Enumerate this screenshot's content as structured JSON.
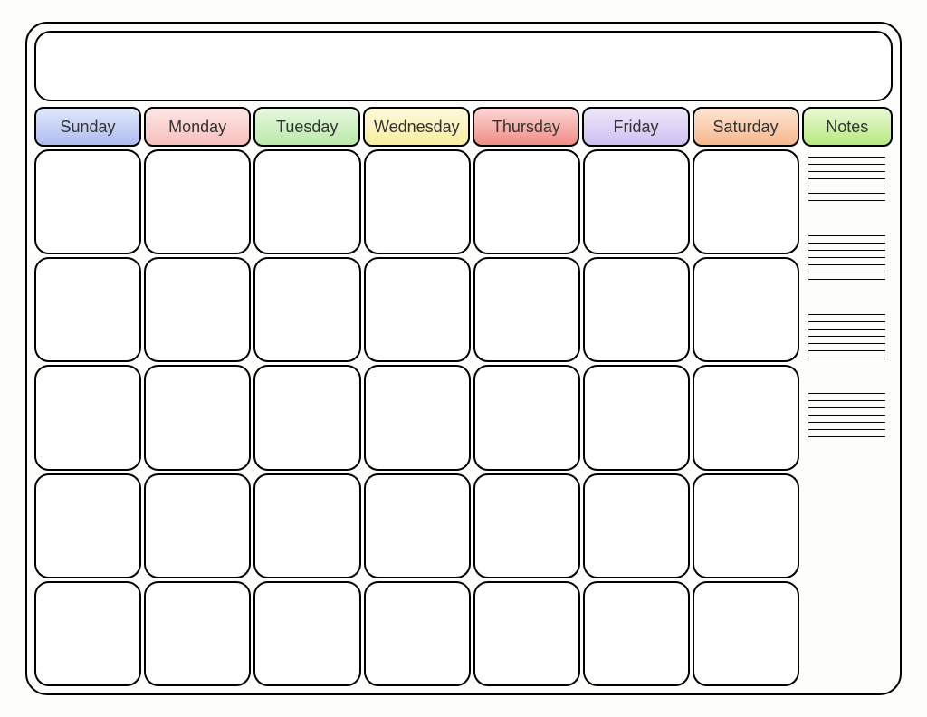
{
  "title": "",
  "headers": [
    {
      "label": "Sunday",
      "color": "c-blue"
    },
    {
      "label": "Monday",
      "color": "c-pink"
    },
    {
      "label": "Tuesday",
      "color": "c-green"
    },
    {
      "label": "Wednesday",
      "color": "c-yellow"
    },
    {
      "label": "Thursday",
      "color": "c-red"
    },
    {
      "label": "Friday",
      "color": "c-purple"
    },
    {
      "label": "Saturday",
      "color": "c-orange"
    }
  ],
  "notes_header": {
    "label": "Notes",
    "color": "c-lime"
  },
  "grid": {
    "rows": 5,
    "cols": 7
  },
  "notes": {
    "sections": 4,
    "lines_per_section": 7
  }
}
